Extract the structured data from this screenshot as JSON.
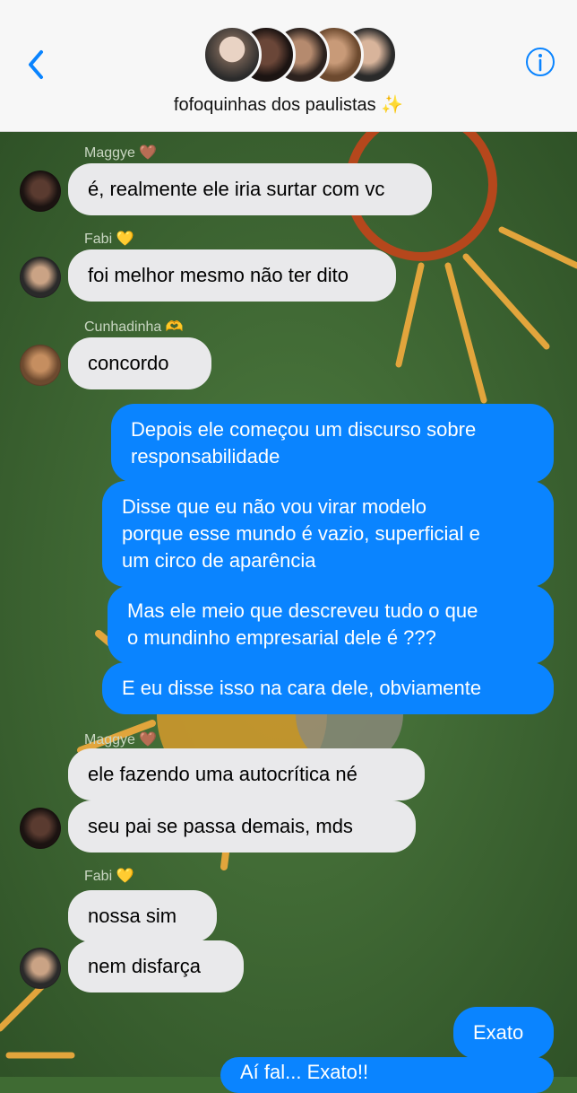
{
  "header": {
    "title": "fofoquinhas dos paulistas",
    "title_emoji": "✨",
    "back_icon": "chevron-left-icon",
    "info_icon": "info-icon"
  },
  "colors": {
    "outgoing_bubble": "#0a84ff",
    "incoming_bubble": "#e9e9eb",
    "wallpaper": "#3f6b33",
    "accent": "#0a84ff"
  },
  "messages": [
    {
      "sender": "Maggye 🤎",
      "text": "é, realmente ele iria surtar com vc"
    },
    {
      "sender": "Fabi 💛",
      "text": "foi melhor mesmo não ter dito"
    },
    {
      "sender": "Cunhadinha 🫶",
      "text": "concordo"
    },
    {
      "sender": "me",
      "text1": "Depois ele começou um discurso sobre",
      "text2": "responsabilidade"
    },
    {
      "sender": "me",
      "text1": "Disse que eu não vou virar modelo",
      "text2": "porque esse mundo é vazio, superficial e",
      "text3": "um circo de aparência"
    },
    {
      "sender": "me",
      "text1": "Mas ele meio que descreveu tudo o que",
      "text2": "o mundinho empresarial dele é ???"
    },
    {
      "sender": "me",
      "text": "E eu disse isso na cara dele, obviamente"
    },
    {
      "sender": "Maggye 🤎",
      "text": "ele fazendo uma autocrítica né"
    },
    {
      "sender": "Maggye 🤎",
      "text": "seu pai se passa demais, mds"
    },
    {
      "sender": "Fabi 💛",
      "text": "nossa sim"
    },
    {
      "sender": "Fabi 💛",
      "text": "nem disfarça"
    },
    {
      "sender": "me",
      "text": "Exato"
    },
    {
      "sender": "me",
      "text": "Aí fal...  Exato!!"
    }
  ]
}
